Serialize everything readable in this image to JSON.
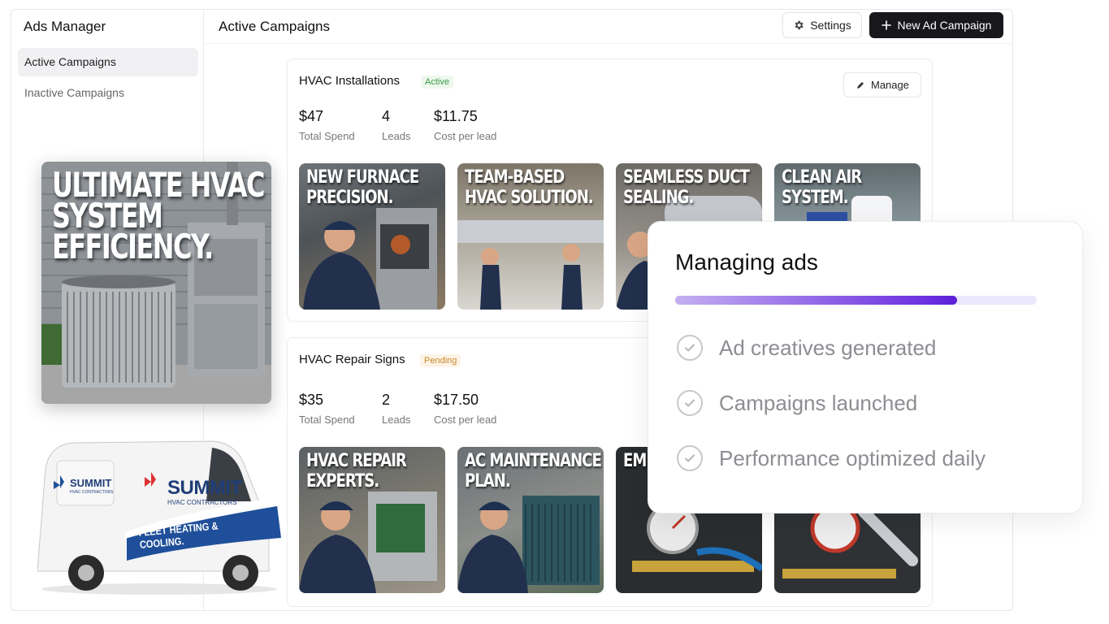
{
  "sidebar": {
    "title": "Ads Manager",
    "items": [
      {
        "label": "Active Campaigns",
        "active": true
      },
      {
        "label": "Inactive Campaigns",
        "active": false
      }
    ]
  },
  "header": {
    "title": "Active Campaigns",
    "settings_label": "Settings",
    "settings_icon": "gear-icon",
    "new_campaign_label": "New Ad Campaign",
    "new_campaign_icon": "plus-icon"
  },
  "campaigns": [
    {
      "name": "HVAC Installations",
      "status": "Active",
      "manage_label": "Manage",
      "manage_icon": "pencil-icon",
      "stats": [
        {
          "value": "$47",
          "label": "Total Spend"
        },
        {
          "value": "4",
          "label": "Leads"
        },
        {
          "value": "$11.75",
          "label": "Cost per lead"
        }
      ],
      "creatives": [
        {
          "caption": "NEW FURNACE PRECISION."
        },
        {
          "caption": "TEAM-BASED HVAC SOLUTION."
        },
        {
          "caption": "SEAMLESS DUCT SEALING."
        },
        {
          "caption": "CLEAN AIR SYSTEM."
        }
      ]
    },
    {
      "name": "HVAC Repair Signs",
      "status": "Pending",
      "stats": [
        {
          "value": "$35",
          "label": "Total Spend"
        },
        {
          "value": "2",
          "label": "Leads"
        },
        {
          "value": "$17.50",
          "label": "Cost per lead"
        }
      ],
      "creatives": [
        {
          "caption": "HVAC REPAIR EXPERTS."
        },
        {
          "caption": "AC MAINTENANCE PLAN."
        },
        {
          "caption": "EM SE"
        },
        {
          "caption": ""
        }
      ]
    }
  ],
  "hero": {
    "caption": "ULTIMATE HVAC SYSTEM EFFICIENCY."
  },
  "van": {
    "brand": "SUMMIT",
    "subtitle": "HVAC CONTRACTORS",
    "slogan": "FLEET HEATING & COOLING."
  },
  "panel": {
    "title": "Managing ads",
    "progress": 0.78,
    "steps": [
      {
        "label": "Ad creatives generated",
        "icon": "check-circle-icon"
      },
      {
        "label": "Campaigns launched",
        "icon": "check-circle-icon"
      },
      {
        "label": "Performance optimized daily",
        "icon": "check-circle-icon"
      }
    ]
  },
  "colors": {
    "primary_button": "#17171c",
    "active_badge": "#3b9a45",
    "pending_badge": "#c98a2c",
    "progress_accent": "#6b2fe0"
  }
}
